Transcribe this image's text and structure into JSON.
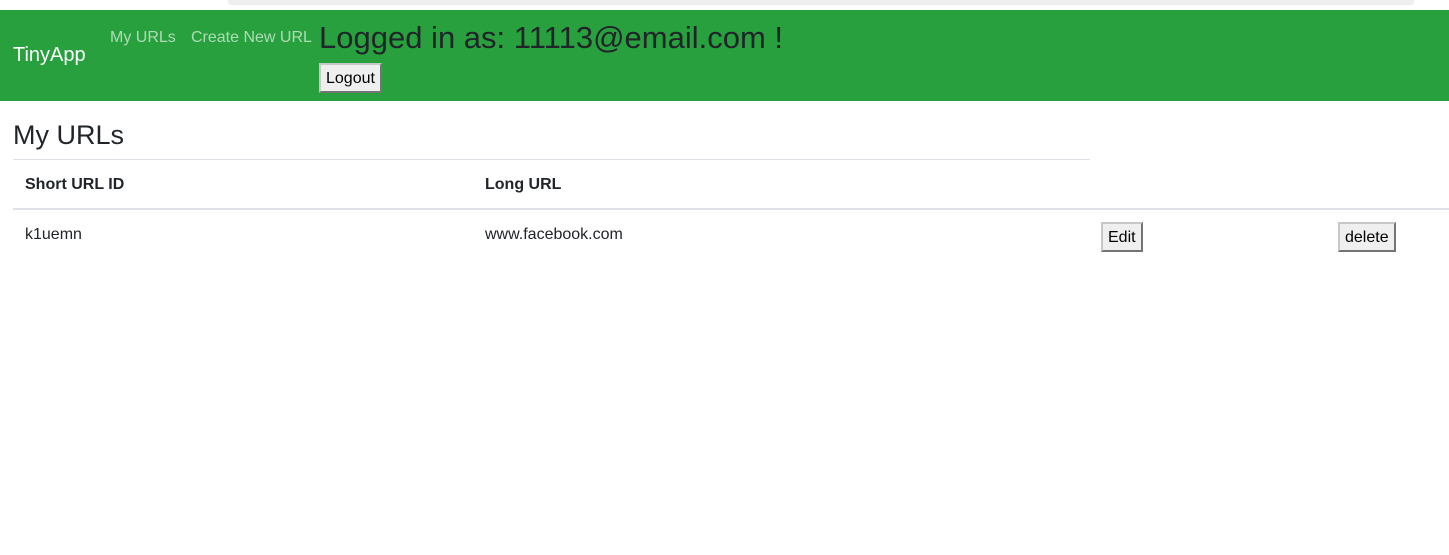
{
  "navbar": {
    "brand": "TinyApp",
    "links": [
      {
        "label": "My URLs"
      },
      {
        "label": "Create New URL"
      }
    ],
    "logged_in_text": "Logged in as: 11113@email.com !",
    "logout_label": "Logout",
    "background_color": "#28a03e"
  },
  "main": {
    "title": "My URLs",
    "table": {
      "columns": [
        "Short URL ID",
        "Long URL"
      ],
      "rows": [
        {
          "short_id": "k1uemn",
          "long_url": "www.facebook.com",
          "edit_label": "Edit",
          "delete_label": "delete"
        }
      ]
    }
  }
}
